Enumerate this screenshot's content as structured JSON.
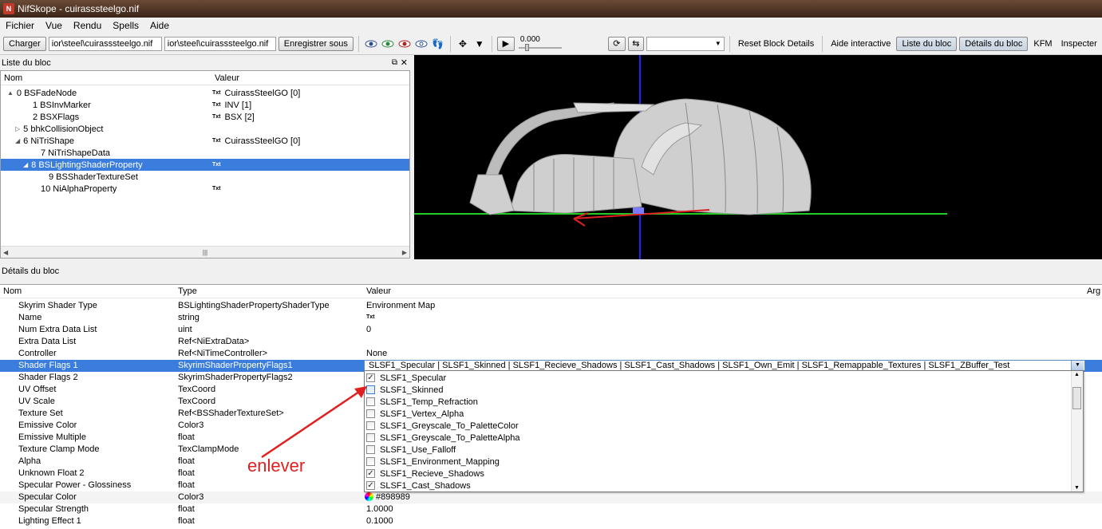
{
  "window": {
    "title": "NifSkope - cuirasssteelgo.nif"
  },
  "menu": [
    "Fichier",
    "Vue",
    "Rendu",
    "Spells",
    "Aide"
  ],
  "toolbar": {
    "load_label": "Charger",
    "path1": "ior\\steel\\cuirasssteelgo.nif",
    "path2": "ior\\steel\\cuirasssteelgo.nif",
    "save_as_label": "Enregistrer sous",
    "time_value": "0.000",
    "reset_block_details": "Reset Block Details",
    "interactive_help": "Aide interactive",
    "block_list": "Liste du bloc",
    "block_details": "Détails du bloc",
    "kfm": "KFM",
    "inspect": "Inspecter"
  },
  "block_list": {
    "title": "Liste du bloc",
    "col_name": "Nom",
    "col_value": "Valeur",
    "rows": [
      {
        "name": "0 BSFadeNode",
        "value": "CuirassSteelGO [0]",
        "arrow": "▲",
        "txt": true,
        "indent": 0
      },
      {
        "name": "1 BSInvMarker",
        "value": "INV [1]",
        "arrow": "",
        "txt": true,
        "indent": 2
      },
      {
        "name": "2 BSXFlags",
        "value": "BSX [2]",
        "arrow": "",
        "txt": true,
        "indent": 2
      },
      {
        "name": "5 bhkCollisionObject",
        "value": "",
        "arrow": "▷",
        "txt": false,
        "indent": 1
      },
      {
        "name": "6 NiTriShape",
        "value": "CuirassSteelGO [0]",
        "arrow": "◢",
        "txt": true,
        "indent": 1
      },
      {
        "name": "7 NiTriShapeData",
        "value": "",
        "arrow": "",
        "txt": false,
        "indent": 3
      },
      {
        "name": "8 BSLightingShaderProperty",
        "value": "",
        "arrow": "◢",
        "txt": true,
        "indent": 2,
        "selected": true
      },
      {
        "name": "9 BSShaderTextureSet",
        "value": "",
        "arrow": "",
        "txt": false,
        "indent": 4
      },
      {
        "name": "10 NiAlphaProperty",
        "value": "",
        "arrow": "",
        "txt": true,
        "indent": 3
      }
    ]
  },
  "block_details": {
    "title": "Détails du bloc",
    "col_name": "Nom",
    "col_type": "Type",
    "col_value": "Valeur",
    "col_arg": "Arg",
    "rows": [
      {
        "name": "Skyrim Shader Type",
        "type": "BSLightingShaderPropertyShaderType",
        "value": "Environment Map"
      },
      {
        "name": "Name",
        "type": "string",
        "value": "Txt"
      },
      {
        "name": "Num Extra Data List",
        "type": "uint",
        "value": "0"
      },
      {
        "name": "Extra Data List",
        "type": "Ref<NiExtraData>",
        "value": ""
      },
      {
        "name": "Controller",
        "type": "Ref<NiTimeController>",
        "value": "None"
      },
      {
        "name": "Shader Flags 1",
        "type": "SkyrimShaderPropertyFlags1",
        "value": "",
        "selected": true
      },
      {
        "name": "Shader Flags 2",
        "type": "SkyrimShaderPropertyFlags2",
        "value": ""
      },
      {
        "name": "UV Offset",
        "type": "TexCoord",
        "value": ""
      },
      {
        "name": "UV Scale",
        "type": "TexCoord",
        "value": ""
      },
      {
        "name": "Texture Set",
        "type": "Ref<BSShaderTextureSet>",
        "value": ""
      },
      {
        "name": "Emissive Color",
        "type": "Color3",
        "value": ""
      },
      {
        "name": "Emissive Multiple",
        "type": "float",
        "value": ""
      },
      {
        "name": "Texture Clamp Mode",
        "type": "TexClampMode",
        "value": ""
      },
      {
        "name": "Alpha",
        "type": "float",
        "value": ""
      },
      {
        "name": "Unknown Float 2",
        "type": "float",
        "value": ""
      },
      {
        "name": "Specular Power - Glossiness",
        "type": "float",
        "value": ""
      },
      {
        "name": "Specular Color",
        "type": "Color3",
        "value": "#898989"
      },
      {
        "name": "Specular Strength",
        "type": "float",
        "value": "1.0000"
      },
      {
        "name": "Lighting Effect 1",
        "type": "float",
        "value": "0.1000"
      }
    ]
  },
  "shader_flags_combo": {
    "value": "SLSF1_Specular | SLSF1_Skinned | SLSF1_Recieve_Shadows | SLSF1_Cast_Shadows | SLSF1_Own_Emit | SLSF1_Remappable_Textures | SLSF1_ZBuffer_Test",
    "options": [
      {
        "label": "SLSF1_Specular",
        "checked": true
      },
      {
        "label": "SLSF1_Skinned",
        "checked": false
      },
      {
        "label": "SLSF1_Temp_Refraction",
        "checked": false
      },
      {
        "label": "SLSF1_Vertex_Alpha",
        "checked": false
      },
      {
        "label": "SLSF1_Greyscale_To_PaletteColor",
        "checked": false
      },
      {
        "label": "SLSF1_Greyscale_To_PaletteAlpha",
        "checked": false
      },
      {
        "label": "SLSF1_Use_Falloff",
        "checked": false
      },
      {
        "label": "SLSF1_Environment_Mapping",
        "checked": false
      },
      {
        "label": "SLSF1_Recieve_Shadows",
        "checked": true
      },
      {
        "label": "SLSF1_Cast_Shadows",
        "checked": true
      }
    ]
  },
  "annotation": {
    "text": "enlever",
    "color": "#e02020"
  },
  "colors": {
    "selection": "#3b7ddd",
    "viewport_bg": "#000000",
    "axis_green": "#22cc22",
    "axis_blue": "#2222ff"
  }
}
